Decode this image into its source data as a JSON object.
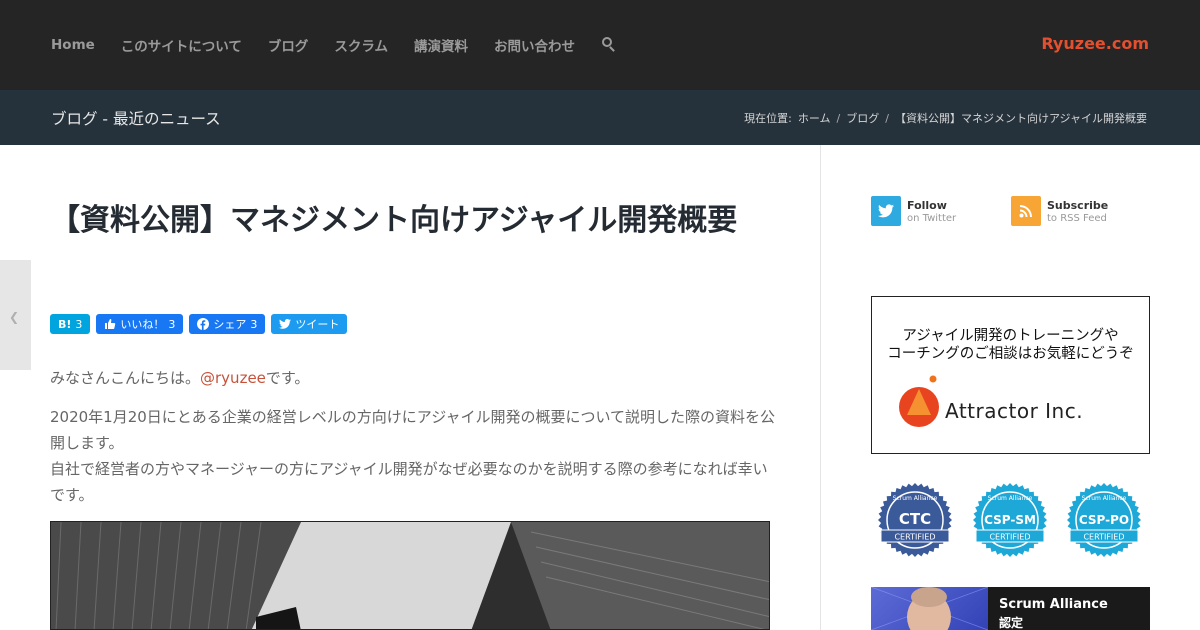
{
  "nav": {
    "items": [
      "Home",
      "このサイトについて",
      "ブログ",
      "スクラム",
      "講演資料",
      "お問い合わせ"
    ],
    "brand": "Ryuzee.com"
  },
  "titlebar": {
    "title": "ブログ - 最近のニュース",
    "breadcrumb_prefix": "現在位置:",
    "breadcrumbs": [
      "ホーム",
      "ブログ",
      "【資料公開】マネジメント向けアジャイル開発概要"
    ]
  },
  "post": {
    "title": "【資料公開】マネジメント向けアジャイル開発概要",
    "share": {
      "hatena_count": "3",
      "like_label": "いいね！",
      "like_count": "3",
      "share_label": "シェア",
      "share_count": "3",
      "tweet_label": "ツイート"
    },
    "greeting_before": "みなさんこんにちは。",
    "greeting_mention": "@ryuzee",
    "greeting_after": "です。",
    "paragraph_line1": "2020年1月20日にとある企業の経営レベルの方向けにアジャイル開発の概要について説明した際の資料を公開します。",
    "paragraph_line2": "自社で経営者の方やマネージャーの方にアジャイル開発がなぜ必要なのかを説明する際の参考になれば幸いです。"
  },
  "sidebar": {
    "twitter": {
      "label": "Follow",
      "sub": "on Twitter"
    },
    "rss": {
      "label": "Subscribe",
      "sub": "to RSS Feed"
    },
    "ad": {
      "line1": "アジャイル開発のトレーニングや",
      "line2": "コーチングのご相談はお気軽にどうぞ",
      "company": "Attractor Inc."
    },
    "badges": [
      {
        "top": "Scrum Alliance",
        "main": "CTC",
        "bottom": "CERTIFIED",
        "color": "#3b5a9a"
      },
      {
        "top": "Scrum Alliance",
        "main": "CSP-SM",
        "bottom": "CERTIFIED",
        "color": "#1ea8d8"
      },
      {
        "top": "Scrum Alliance",
        "main": "CSP-PO",
        "bottom": "CERTIFIED",
        "color": "#1ea8d8"
      }
    ],
    "cert": {
      "line1": "Scrum Alliance",
      "line2": "認定"
    }
  },
  "colors": {
    "header_bg": "#252525",
    "titlebar_bg": "#26323b",
    "brand": "#e2502f",
    "mention": "#c7523a"
  }
}
